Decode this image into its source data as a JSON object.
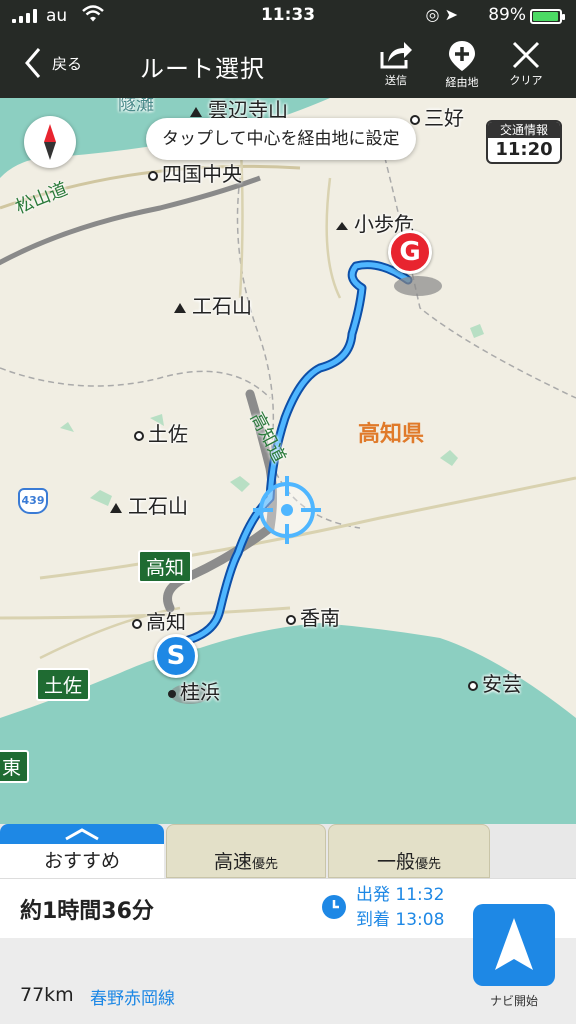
{
  "status_bar": {
    "carrier": "au",
    "time": "11:33",
    "battery": "89%",
    "battery_level": 0.89
  },
  "nav": {
    "back_label": "戻る",
    "title": "ルート選択",
    "buttons": [
      {
        "label": "送信",
        "icon": "share-icon"
      },
      {
        "label": "経由地",
        "icon": "add-waypoint-icon"
      },
      {
        "label": "クリア",
        "icon": "close-icon"
      }
    ]
  },
  "map": {
    "tooltip": "タップして中心を経由地に設定",
    "traffic": {
      "label": "交通情報",
      "time": "11:20"
    },
    "prefecture": "高知県",
    "places": {
      "unzen_ji": "雲辺寺山",
      "miyoshi": "三好",
      "shikoku_chuo": "四国中央",
      "koboke": "小歩危",
      "ishizuchi_1": "工石山",
      "tosa_1": "土佐",
      "ishizuchi_2": "工石山",
      "kochi": "高知",
      "konan": "香南",
      "katsurahama": "桂浜",
      "aki": "安芸",
      "tunnel": "隧灘",
      "higashi": "東"
    },
    "highway_signs": {
      "kochi": "高知",
      "tosa": "土佐"
    },
    "road_names": {
      "matsuyama": "松山道",
      "kochi": "高知道"
    },
    "route_number": "439",
    "start_marker": "S",
    "goal_marker": "G"
  },
  "panel": {
    "tabs": [
      {
        "main": "おすすめ",
        "sub": ""
      },
      {
        "main": "高速",
        "sub": "優先"
      },
      {
        "main": "一般",
        "sub": "優先"
      }
    ],
    "duration": "約1時間36分",
    "departure": "出発 11:32",
    "arrival": "到着 13:08",
    "distance": "77km",
    "via": "春野赤岡線",
    "navi_label": "ナビ開始"
  },
  "colors": {
    "route": "#1e88e5",
    "header": "#262a26",
    "sea": "#8ccfc1",
    "goal": "#e8242f",
    "highway": "#1f6b32"
  }
}
